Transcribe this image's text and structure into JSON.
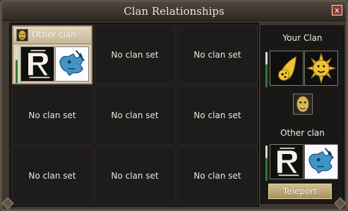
{
  "window": {
    "title": "Clan Relationships",
    "close_label": "x"
  },
  "selected_cell": {
    "name": "Other clan"
  },
  "empty_label": "No clan set",
  "cells": [
    {
      "label": "No clan set"
    },
    {
      "label": "No clan set"
    },
    {
      "label": "No clan set"
    },
    {
      "label": "No clan set"
    },
    {
      "label": "No clan set"
    },
    {
      "label": "No clan set"
    },
    {
      "label": "No clan set"
    },
    {
      "label": "No clan set"
    }
  ],
  "side_panel": {
    "your_clan_label": "Your Clan",
    "other_clan_label": "Other clan",
    "teleport_label": "Teleport"
  },
  "icons": {
    "clan_crest_left": "r-emblem-icon",
    "clan_crest_right": "dragon-skull-icon",
    "your_clan_left": "flaming-meteor-icon",
    "your_clan_right": "sun-face-icon",
    "mid": "golden-mask-icon"
  },
  "colors": {
    "selected_header": "#ddd0b8",
    "teleport_button": "#c2b17f",
    "status_green": "#2e7a35"
  }
}
